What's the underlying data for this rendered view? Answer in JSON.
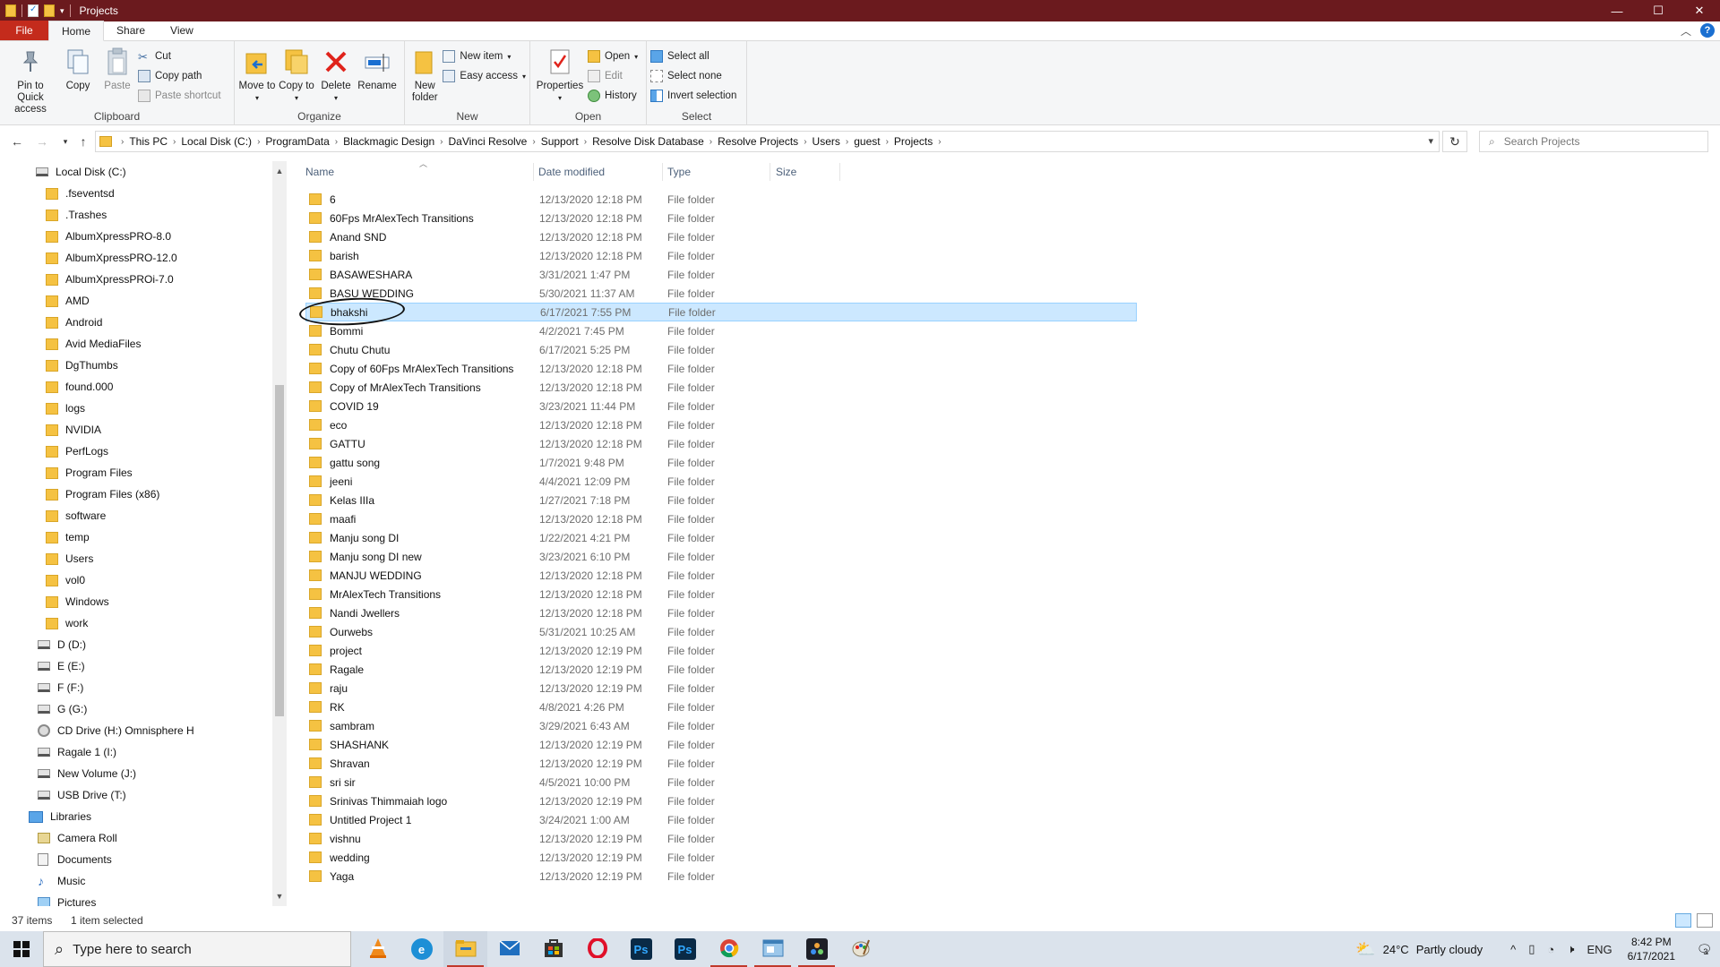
{
  "window": {
    "title": "Projects",
    "controls": {
      "minimize": "—",
      "maximize": "☐",
      "close": "✕"
    }
  },
  "ribbon_tabs": [
    "File",
    "Home",
    "Share",
    "View"
  ],
  "ribbon": {
    "clipboard": {
      "label": "Clipboard",
      "pin": "Pin to Quick access",
      "copy": "Copy",
      "paste": "Paste",
      "cut": "Cut",
      "copy_path": "Copy path",
      "paste_shortcut": "Paste shortcut"
    },
    "organize": {
      "label": "Organize",
      "move_to": "Move to",
      "copy_to": "Copy to",
      "delete": "Delete",
      "rename": "Rename"
    },
    "new": {
      "label": "New",
      "new_folder": "New folder",
      "new_item": "New item",
      "easy_access": "Easy access"
    },
    "open": {
      "label": "Open",
      "properties": "Properties",
      "open": "Open",
      "edit": "Edit",
      "history": "History"
    },
    "select": {
      "label": "Select",
      "select_all": "Select all",
      "select_none": "Select none",
      "invert": "Invert selection"
    }
  },
  "address": {
    "crumbs": [
      "This PC",
      "Local Disk (C:)",
      "ProgramData",
      "Blackmagic Design",
      "DaVinci Resolve",
      "Support",
      "Resolve Disk Database",
      "Resolve Projects",
      "Users",
      "guest",
      "Projects"
    ],
    "search_placeholder": "Search Projects"
  },
  "nav": {
    "local_disk": "Local Disk (C:)",
    "folders": [
      ".fseventsd",
      ".Trashes",
      "AlbumXpressPRO-8.0",
      "AlbumXpressPRO-12.0",
      "AlbumXpressPROi-7.0",
      "AMD",
      "Android",
      "Avid MediaFiles",
      "DgThumbs",
      "found.000",
      "logs",
      "NVIDIA",
      "PerfLogs",
      "Program Files",
      "Program Files (x86)",
      "software",
      "temp",
      "Users",
      "vol0",
      "Windows",
      "work"
    ],
    "drives": [
      "D (D:)",
      "E (E:)",
      "F (F:)",
      "G (G:)"
    ],
    "cd_drive": "CD Drive (H:) Omnisphere H",
    "drives2": [
      "Ragale 1 (I:)",
      "New Volume (J:)",
      "USB Drive (T:)"
    ],
    "libraries": "Libraries",
    "lib_items": [
      "Camera Roll",
      "Documents",
      "Music",
      "Pictures"
    ]
  },
  "columns": {
    "name": "Name",
    "date": "Date modified",
    "type": "Type",
    "size": "Size"
  },
  "files": [
    [
      "6",
      "12/13/2020 12:18 PM",
      "File folder"
    ],
    [
      "60Fps MrAlexTech Transitions",
      "12/13/2020 12:18 PM",
      "File folder"
    ],
    [
      "Anand SND",
      "12/13/2020 12:18 PM",
      "File folder"
    ],
    [
      "barish",
      "12/13/2020 12:18 PM",
      "File folder"
    ],
    [
      "BASAWESHARA",
      "3/31/2021 1:47 PM",
      "File folder"
    ],
    [
      "BASU WEDDING",
      "5/30/2021 11:37 AM",
      "File folder"
    ],
    [
      "bhakshi",
      "6/17/2021 7:55 PM",
      "File folder"
    ],
    [
      "Bommi",
      "4/2/2021 7:45 PM",
      "File folder"
    ],
    [
      "Chutu Chutu",
      "6/17/2021 5:25 PM",
      "File folder"
    ],
    [
      "Copy of 60Fps MrAlexTech Transitions",
      "12/13/2020 12:18 PM",
      "File folder"
    ],
    [
      "Copy of MrAlexTech Transitions",
      "12/13/2020 12:18 PM",
      "File folder"
    ],
    [
      "COVID 19",
      "3/23/2021 11:44 PM",
      "File folder"
    ],
    [
      "eco",
      "12/13/2020 12:18 PM",
      "File folder"
    ],
    [
      "GATTU",
      "12/13/2020 12:18 PM",
      "File folder"
    ],
    [
      "gattu song",
      "1/7/2021 9:48 PM",
      "File folder"
    ],
    [
      "jeeni",
      "4/4/2021 12:09 PM",
      "File folder"
    ],
    [
      "Kelas IIIa",
      "1/27/2021 7:18 PM",
      "File folder"
    ],
    [
      "maafi",
      "12/13/2020 12:18 PM",
      "File folder"
    ],
    [
      "Manju song DI",
      "1/22/2021 4:21 PM",
      "File folder"
    ],
    [
      "Manju song DI new",
      "3/23/2021 6:10 PM",
      "File folder"
    ],
    [
      "MANJU WEDDING",
      "12/13/2020 12:18 PM",
      "File folder"
    ],
    [
      "MrAlexTech Transitions",
      "12/13/2020 12:18 PM",
      "File folder"
    ],
    [
      "Nandi Jwellers",
      "12/13/2020 12:18 PM",
      "File folder"
    ],
    [
      "Ourwebs",
      "5/31/2021 10:25 AM",
      "File folder"
    ],
    [
      "project",
      "12/13/2020 12:19 PM",
      "File folder"
    ],
    [
      "Ragale",
      "12/13/2020 12:19 PM",
      "File folder"
    ],
    [
      "raju",
      "12/13/2020 12:19 PM",
      "File folder"
    ],
    [
      "RK",
      "4/8/2021 4:26 PM",
      "File folder"
    ],
    [
      "sambram",
      "3/29/2021 6:43 AM",
      "File folder"
    ],
    [
      "SHASHANK",
      "12/13/2020 12:19 PM",
      "File folder"
    ],
    [
      "Shravan",
      "12/13/2020 12:19 PM",
      "File folder"
    ],
    [
      "sri sir",
      "4/5/2021 10:00 PM",
      "File folder"
    ],
    [
      "Srinivas Thimmaiah logo",
      "12/13/2020 12:19 PM",
      "File folder"
    ],
    [
      "Untitled Project 1",
      "3/24/2021 1:00 AM",
      "File folder"
    ],
    [
      "vishnu",
      "12/13/2020 12:19 PM",
      "File folder"
    ],
    [
      "wedding",
      "12/13/2020 12:19 PM",
      "File folder"
    ],
    [
      "Yaga",
      "12/13/2020 12:19 PM",
      "File folder"
    ]
  ],
  "selected_file": "bhakshi",
  "status": {
    "count": "37 items",
    "selected": "1 item selected"
  },
  "taskbar": {
    "search_placeholder": "Type here to search",
    "weather_temp": "24°C",
    "weather_text": "Partly cloudy",
    "lang": "ENG",
    "time": "8:42 PM",
    "date": "6/17/2021",
    "notifications": "3"
  },
  "colors": {
    "titlebar": "#6b1a1e",
    "file_tab": "#c42b1c",
    "selection": "#cce8ff",
    "folder": "#f5c242"
  }
}
